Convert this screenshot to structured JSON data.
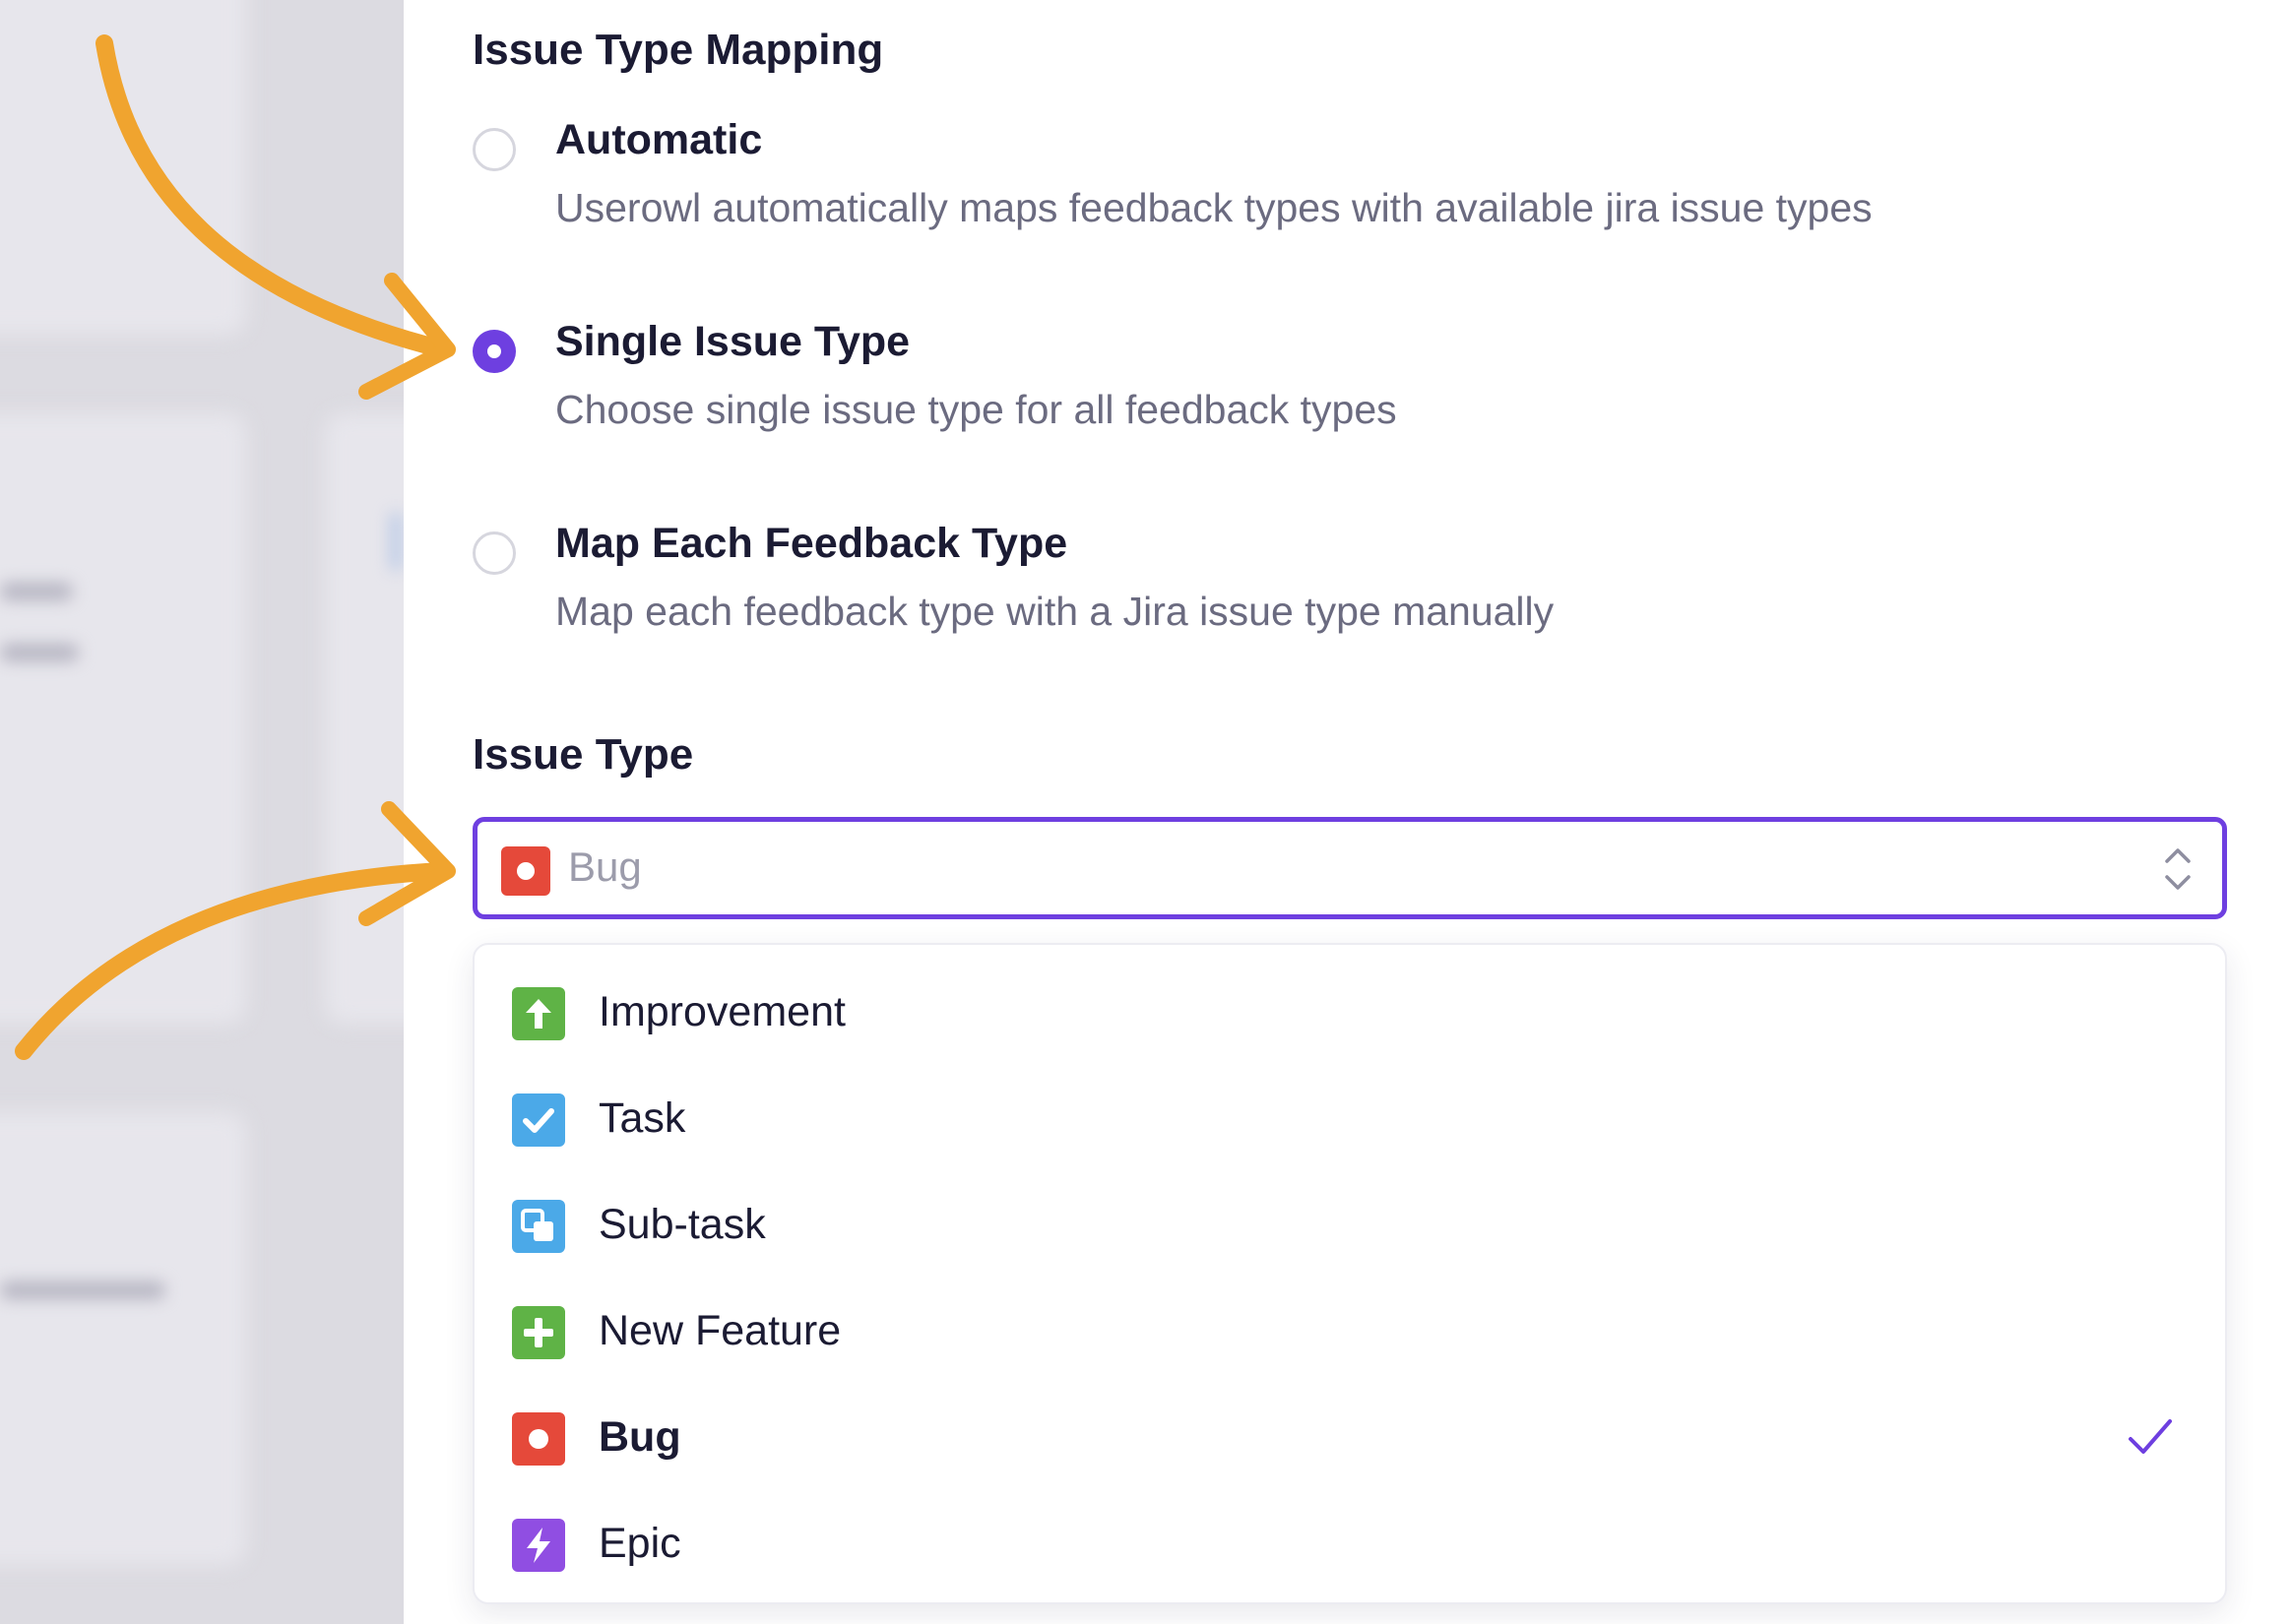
{
  "issue_type_mapping": {
    "title": "Issue Type Mapping",
    "options": [
      {
        "label": "Automatic",
        "description": "Userowl automatically maps feedback types with available jira issue types",
        "checked": false
      },
      {
        "label": "Single Issue Type",
        "description": "Choose single issue type for all feedback types",
        "checked": true
      },
      {
        "label": "Map Each Feedback Type",
        "description": "Map each feedback type with a Jira issue type manually",
        "checked": false
      }
    ]
  },
  "issue_type": {
    "label": "Issue Type",
    "selected_value": "Bug",
    "selected_icon": "bug-icon",
    "options": [
      {
        "label": "Improvement",
        "icon": "improvement-icon",
        "color": "#5fb346",
        "selected": false
      },
      {
        "label": "Task",
        "icon": "task-icon",
        "color": "#4ba9e8",
        "selected": false
      },
      {
        "label": "Sub-task",
        "icon": "subtask-icon",
        "color": "#4ba9e8",
        "selected": false
      },
      {
        "label": "New Feature",
        "icon": "new-feature-icon",
        "color": "#5fb346",
        "selected": false
      },
      {
        "label": "Bug",
        "icon": "bug-icon",
        "color": "#e5493a",
        "selected": true
      },
      {
        "label": "Epic",
        "icon": "epic-icon",
        "color": "#904ee2",
        "selected": false
      }
    ]
  },
  "colors": {
    "accent": "#6e3fe0",
    "annotation_arrow": "#f0a42f"
  }
}
